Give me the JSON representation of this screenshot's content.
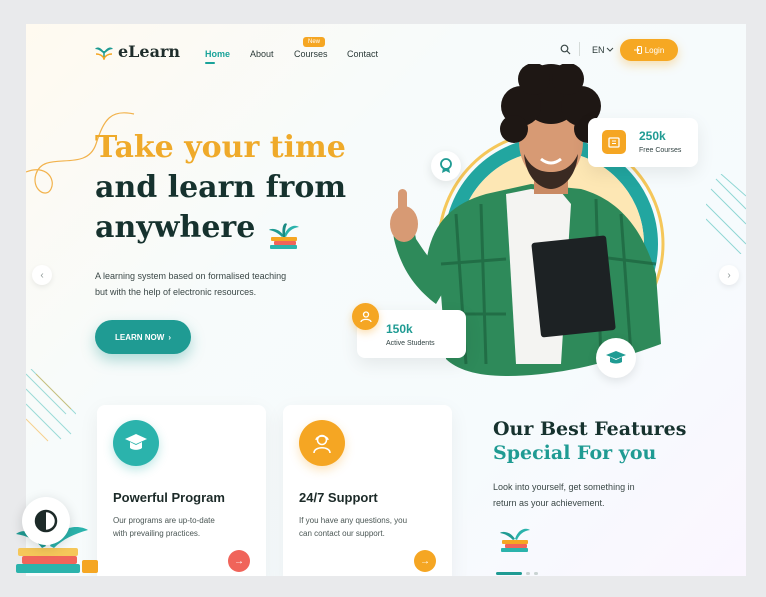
{
  "brand": {
    "name": "eLearn"
  },
  "nav": {
    "items": [
      {
        "label": "Home",
        "active": true
      },
      {
        "label": "About",
        "active": false
      },
      {
        "label": "Courses",
        "badge": "New",
        "active": false
      },
      {
        "label": "Contact",
        "active": false
      }
    ],
    "language": "EN",
    "login_label": "Login"
  },
  "hero": {
    "title_line1": "Take your time",
    "title_line2": "and learn from",
    "title_line3": "anywhere",
    "description_line1": "A learning system based on formalised teaching",
    "description_line2": "but with the help of electronic resources.",
    "cta_label": "LEARN NOW"
  },
  "stats": {
    "courses": {
      "value": "250k",
      "label": "Free Courses"
    },
    "students": {
      "value": "150k",
      "label": "Active Students"
    }
  },
  "features": {
    "cards": [
      {
        "title": "Powerful Program",
        "text_line1": "Our programs are up-to-date",
        "text_line2": "with prevailing practices.",
        "icon": "graduation-cap-icon",
        "color": "#2bb3ac",
        "button_color": "#f0645a"
      },
      {
        "title": "24/7 Support",
        "text_line1": "If you have any questions, you",
        "text_line2": "can contact our support.",
        "icon": "support-agent-icon",
        "color": "#f5a623",
        "button_color": "#f5a623"
      }
    ],
    "heading_line1": "Our Best Features",
    "heading_line2": "Special For you",
    "description_line1": "Look into yourself, get something in",
    "description_line2": "return as your achievement."
  },
  "colors": {
    "accent": "#1f9b93",
    "highlight": "#f6a823",
    "dark": "#16322e"
  }
}
